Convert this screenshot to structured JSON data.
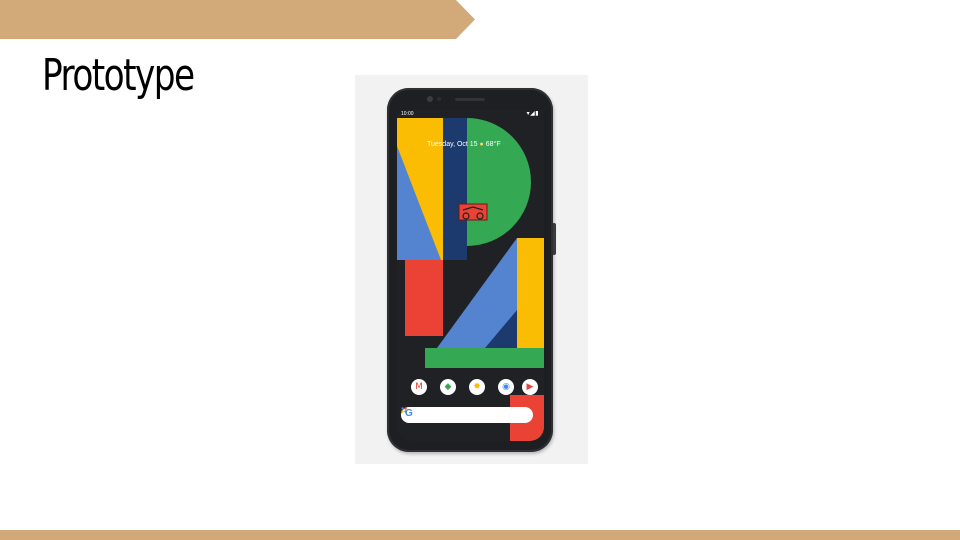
{
  "slide": {
    "title": "Prototype",
    "accent_color": "#d2aa7a"
  },
  "phone": {
    "status_time": "10:00",
    "status_icons": "▾◢▮",
    "date_text": "Tuesday, Oct 15",
    "weather_symbol": "●",
    "temperature": "68°F",
    "dock_apps": [
      {
        "icon": "gmail-icon",
        "glyph": "M",
        "color": "#ea4335"
      },
      {
        "icon": "maps-icon",
        "glyph": "◆",
        "color": "#34a853"
      },
      {
        "icon": "photos-icon",
        "glyph": "✸",
        "color": "#fbbc04"
      },
      {
        "icon": "chrome-icon",
        "glyph": "◉",
        "color": "#4285f4"
      },
      {
        "icon": "youtube-icon",
        "glyph": "▶",
        "color": "#ea4335"
      }
    ],
    "search_logo": "G",
    "colors": {
      "yellow": "#fbbc04",
      "blue": "#5484d0",
      "navy": "#1c3a6e",
      "green": "#34a853",
      "red": "#ea4335",
      "dark": "#202124"
    }
  }
}
